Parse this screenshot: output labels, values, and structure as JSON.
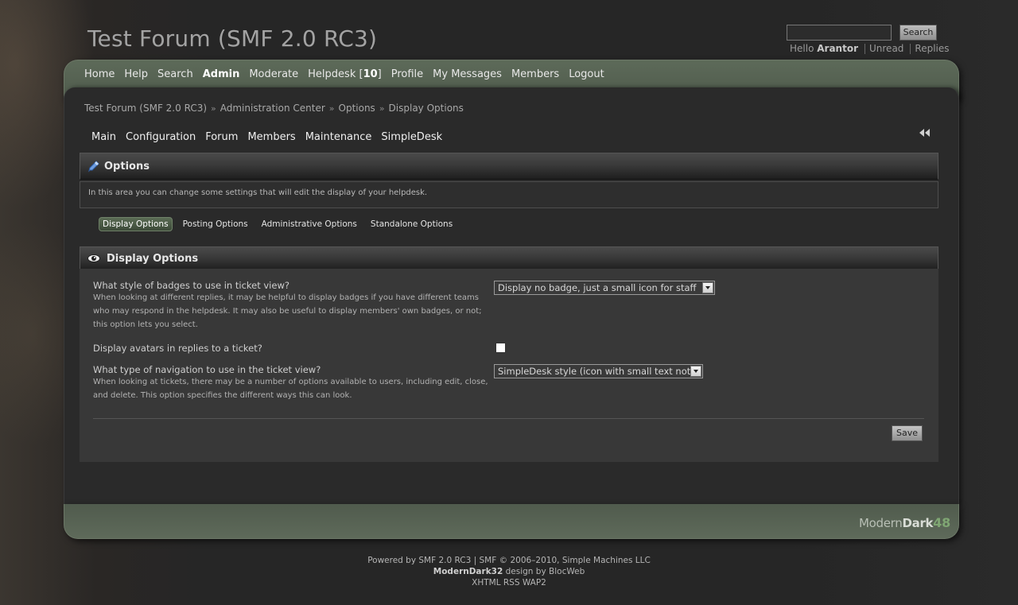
{
  "header": {
    "forum_title": "Test Forum (SMF 2.0 RC3)",
    "search_button": "Search",
    "search_value": "",
    "hello_prefix": "Hello",
    "username": "Arantor",
    "unread": "Unread",
    "replies": "Replies"
  },
  "main_nav": {
    "home": "Home",
    "help": "Help",
    "search": "Search",
    "admin": "Admin",
    "moderate": "Moderate",
    "helpdesk_label": "Helpdesk [",
    "helpdesk_count": "10",
    "helpdesk_close": "]",
    "profile": "Profile",
    "my_messages": "My Messages",
    "members": "Members",
    "logout": "Logout"
  },
  "breadcrumb": {
    "items": [
      "Test Forum (SMF 2.0 RC3)",
      "Administration Center",
      "Options",
      "Display Options"
    ],
    "separator": "»"
  },
  "admin_menu": {
    "main": "Main",
    "configuration": "Configuration",
    "forum": "Forum",
    "members": "Members",
    "maintenance": "Maintenance",
    "simpledesk": "SimpleDesk"
  },
  "options_section": {
    "title": "Options",
    "description": "In this area you can change some settings that will edit the display of your helpdesk."
  },
  "subtabs": {
    "display": "Display Options",
    "posting": "Posting Options",
    "administrative": "Administrative Options",
    "standalone": "Standalone Options"
  },
  "display_section": {
    "title": "Display Options",
    "settings": [
      {
        "question": "What style of badges to use in ticket view?",
        "description": "When looking at different replies, it may be helpful to display badges if you have different teams who may respond in the helpdesk. It may also be useful to display members' own badges, or not; this option lets you select.",
        "selected": "Display no badge, just a small icon for staff"
      },
      {
        "question": "Display avatars in replies to a ticket?",
        "checked": false
      },
      {
        "question": "What type of navigation to use in the ticket view?",
        "description": "When looking at tickets, there may be a number of options available to users, including edit, close, and delete. This option specifies the different ways this can look.",
        "selected": "SimpleDesk style (icon with small text note)"
      }
    ],
    "save_button": "Save"
  },
  "brand": {
    "modern": "Modern",
    "dark": "Dark",
    "number": "48"
  },
  "footer": {
    "line1": "Powered by SMF 2.0 RC3 | SMF © 2006–2010, Simple Machines LLC",
    "theme_name": "ModernDark32",
    "design_by": " design by BlocWeb",
    "line3": "XHTML RSS WAP2"
  },
  "colors": {
    "frame_green": "#5d6a59",
    "panel_bg": "#383838",
    "content_bg": "#2a2a2a",
    "active_tab": "#4a5b45"
  }
}
